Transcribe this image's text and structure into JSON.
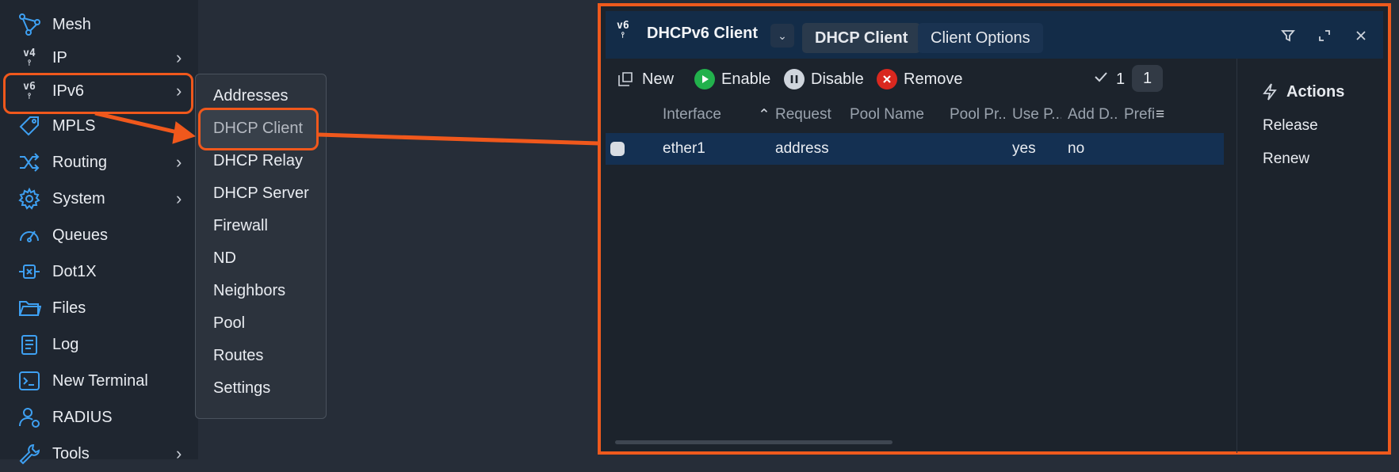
{
  "sidebar": {
    "items": [
      {
        "label": "Mesh",
        "icon": "mesh-icon"
      },
      {
        "label": "IP",
        "icon": "ipv4-icon",
        "has_submenu": true,
        "glyph": "v4"
      },
      {
        "label": "IPv6",
        "icon": "ipv6-icon",
        "has_submenu": true,
        "glyph": "v6"
      },
      {
        "label": "MPLS",
        "icon": "tag-icon"
      },
      {
        "label": "Routing",
        "icon": "routing-shuffle-icon",
        "has_submenu": true
      },
      {
        "label": "System",
        "icon": "gear-icon",
        "has_submenu": true
      },
      {
        "label": "Queues",
        "icon": "gauge-icon"
      },
      {
        "label": "Dot1X",
        "icon": "dot1x-icon"
      },
      {
        "label": "Files",
        "icon": "folder-icon"
      },
      {
        "label": "Log",
        "icon": "log-icon"
      },
      {
        "label": "New Terminal",
        "icon": "terminal-icon"
      },
      {
        "label": "RADIUS",
        "icon": "user-gear-icon"
      },
      {
        "label": "Tools",
        "icon": "wrench-icon",
        "has_submenu": true
      }
    ],
    "chevron": "›"
  },
  "submenu": {
    "items": [
      "Addresses",
      "DHCP Client",
      "DHCP Relay",
      "DHCP Server",
      "Firewall",
      "ND",
      "Neighbors",
      "Pool",
      "Routes",
      "Settings"
    ]
  },
  "window": {
    "icon_glyph": "v6",
    "title": "DHCPv6 Client",
    "tabs": [
      "DHCP Client",
      "Client Options"
    ],
    "toolbar": {
      "new": "New",
      "enable": "Enable",
      "disable": "Disable",
      "remove": "Remove",
      "selected_count": "1",
      "total_count": "1"
    },
    "columns": [
      "Interface",
      "Request",
      "Pool Name",
      "Pool Pr...",
      "Use P...",
      "Add D...",
      "Prefi"
    ],
    "rows": [
      {
        "interface": "ether1",
        "request": "address",
        "pool_name": "",
        "pool_prefix": "",
        "use_peer": "yes",
        "add_default": "no"
      }
    ],
    "actions": {
      "title": "Actions",
      "items": [
        "Release",
        "Renew"
      ]
    }
  },
  "colors": {
    "accent": "#f0581c",
    "titlebar": "#132c48",
    "icon_blue": "#3ea0f2",
    "enable_green": "#22b14c",
    "remove_red": "#d9281f"
  }
}
